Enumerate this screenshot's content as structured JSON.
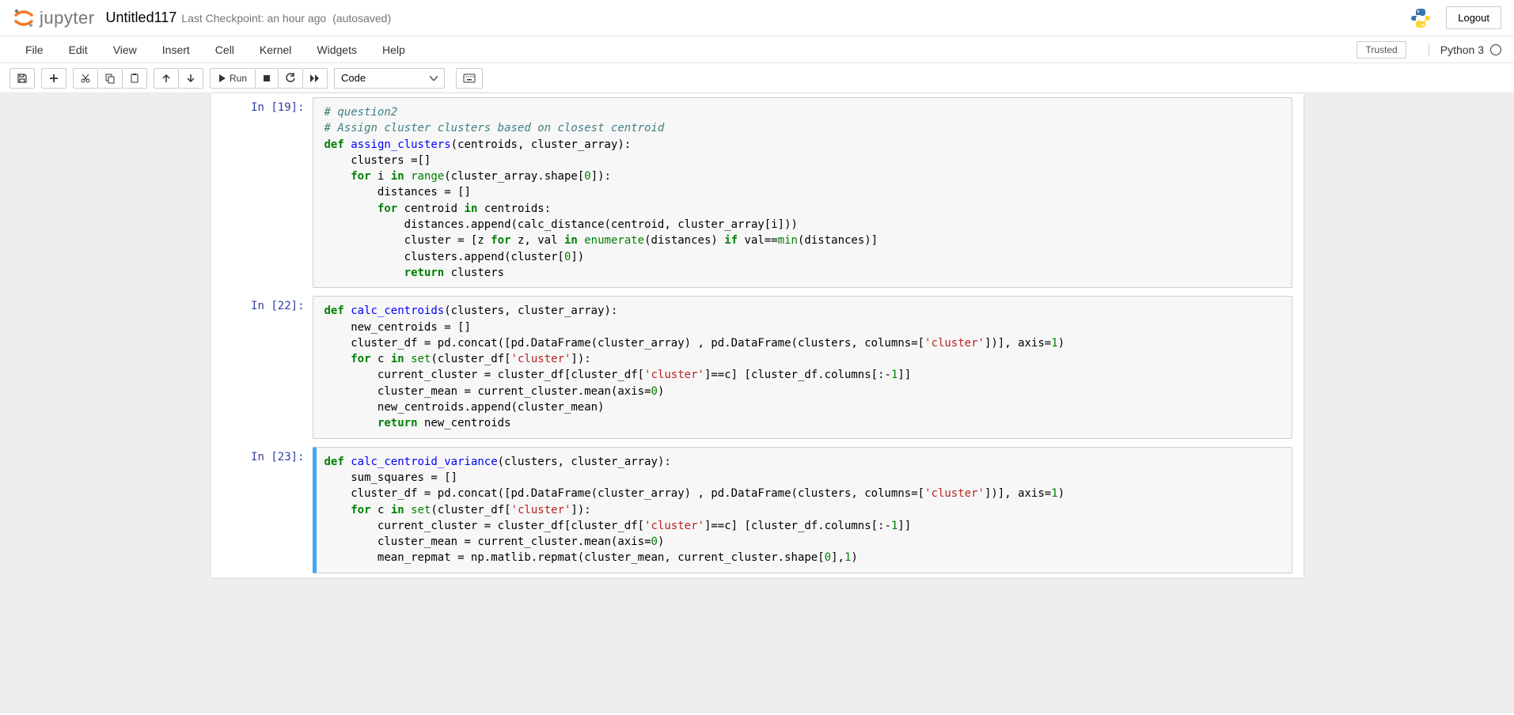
{
  "header": {
    "logo_text": "jupyter",
    "notebook_name": "Untitled117",
    "checkpoint": "Last Checkpoint: an hour ago",
    "autosave": "(autosaved)",
    "logout": "Logout"
  },
  "menubar": {
    "items": [
      "File",
      "Edit",
      "View",
      "Insert",
      "Cell",
      "Kernel",
      "Widgets",
      "Help"
    ],
    "trusted": "Trusted",
    "kernel": "Python 3"
  },
  "toolbar": {
    "run_label": "Run",
    "celltype": "Code"
  },
  "cells": [
    {
      "prompt": "In [19]:",
      "selected": false,
      "code_html": "<span class=\"cm-comment\"># question2</span>\n<span class=\"cm-comment\"># Assign cluster clusters based on closest centroid</span>\n<span class=\"cm-keyword\">def</span> <span class=\"cm-def\">assign_clusters</span>(centroids, cluster_array):\n    clusters =[]\n    <span class=\"cm-keyword\">for</span> i <span class=\"cm-keyword\">in</span> <span class=\"cm-builtin\">range</span>(cluster_array.shape[<span class=\"cm-number\">0</span>]):\n        distances = []\n        <span class=\"cm-keyword\">for</span> centroid <span class=\"cm-keyword\">in</span> centroids:\n            distances.append(calc_distance(centroid, cluster_array[i]))\n            cluster = [z <span class=\"cm-keyword\">for</span> z, val <span class=\"cm-keyword\">in</span> <span class=\"cm-builtin\">enumerate</span>(distances) <span class=\"cm-keyword\">if</span> val==<span class=\"cm-builtin\">min</span>(distances)]\n            clusters.append(cluster[<span class=\"cm-number\">0</span>])\n            <span class=\"cm-keyword\">return</span> clusters"
    },
    {
      "prompt": "In [22]:",
      "selected": false,
      "code_html": "<span class=\"cm-keyword\">def</span> <span class=\"cm-def\">calc_centroids</span>(clusters, cluster_array):\n    new_centroids = []\n    cluster_df = pd.concat([pd.DataFrame(cluster_array) , pd.DataFrame(clusters, columns=[<span class=\"cm-string\">'cluster'</span>])], axis=<span class=\"cm-number\">1</span>)\n    <span class=\"cm-keyword\">for</span> c <span class=\"cm-keyword\">in</span> <span class=\"cm-builtin\">set</span>(cluster_df[<span class=\"cm-string\">'cluster'</span>]):\n        current_cluster = cluster_df[cluster_df[<span class=\"cm-string\">'cluster'</span>]==c] [cluster_df.columns[:-<span class=\"cm-number\">1</span>]]\n        cluster_mean = current_cluster.mean(axis=<span class=\"cm-number\">0</span>)\n        new_centroids.append(cluster_mean)\n        <span class=\"cm-keyword\">return</span> new_centroids"
    },
    {
      "prompt": "In [23]:",
      "selected": true,
      "code_html": "<span class=\"cm-keyword\">def</span> <span class=\"cm-def\">calc_centroid_variance</span>(clusters, cluster_array):\n    sum_squares = []\n    cluster_df = pd.concat([pd.DataFrame(cluster_array) , pd.DataFrame(clusters, columns=[<span class=\"cm-string\">'cluster'</span>])], axis=<span class=\"cm-number\">1</span>)\n    <span class=\"cm-keyword\">for</span> c <span class=\"cm-keyword\">in</span> <span class=\"cm-builtin\">set</span>(cluster_df[<span class=\"cm-string\">'cluster'</span>]):\n        current_cluster = cluster_df[cluster_df[<span class=\"cm-string\">'cluster'</span>]==c] [cluster_df.columns[:-<span class=\"cm-number\">1</span>]]\n        cluster_mean = current_cluster.mean(axis=<span class=\"cm-number\">0</span>)\n        mean_repmat = np.matlib.repmat(cluster_mean, current_cluster.shape[<span class=\"cm-number\">0</span>],<span class=\"cm-number\">1</span>)"
    }
  ]
}
